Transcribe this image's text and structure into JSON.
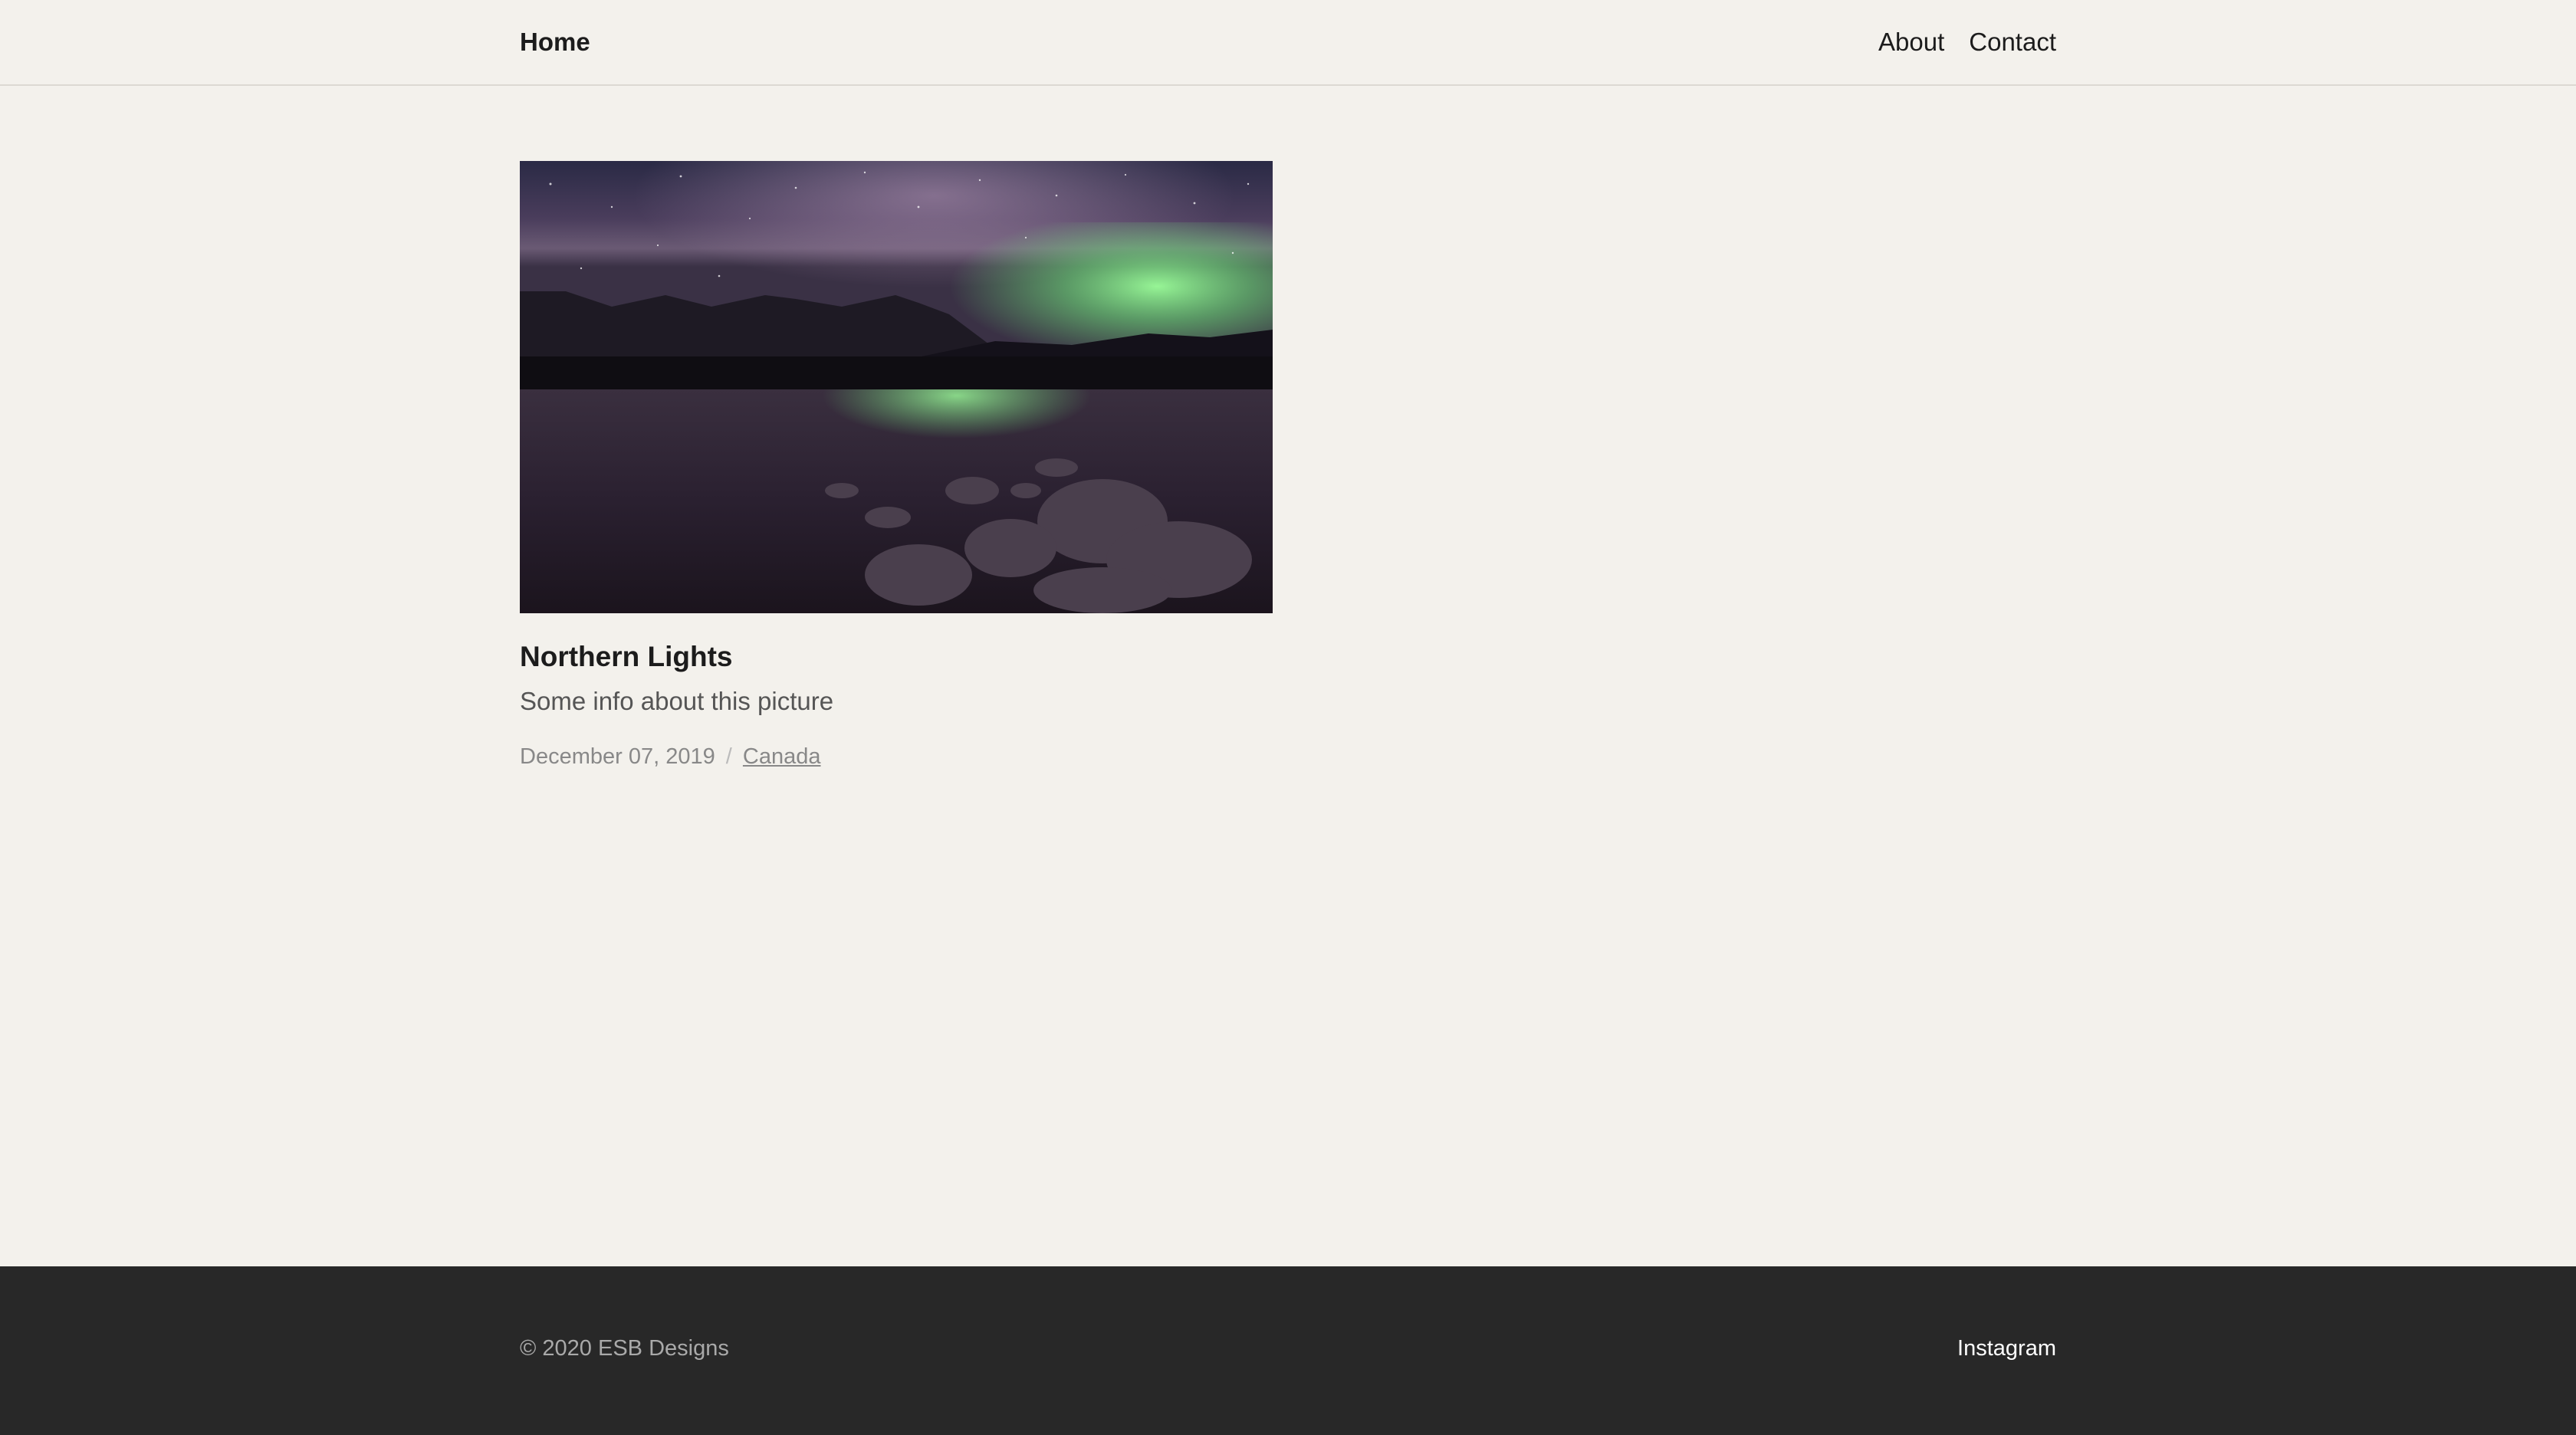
{
  "header": {
    "brand": "Home",
    "nav": [
      {
        "label": "About"
      },
      {
        "label": "Contact"
      }
    ]
  },
  "post": {
    "image_icon": "northern-lights-photo",
    "title": "Northern Lights",
    "description": "Some info about this picture",
    "date": "December 07, 2019",
    "separator": "/",
    "category": "Canada"
  },
  "footer": {
    "copyright": "© 2020 ESB Designs",
    "link": "Instagram"
  },
  "colors": {
    "background": "#f3f1ec",
    "footer_background": "#282828",
    "aurora_green": "#7cf08a"
  }
}
